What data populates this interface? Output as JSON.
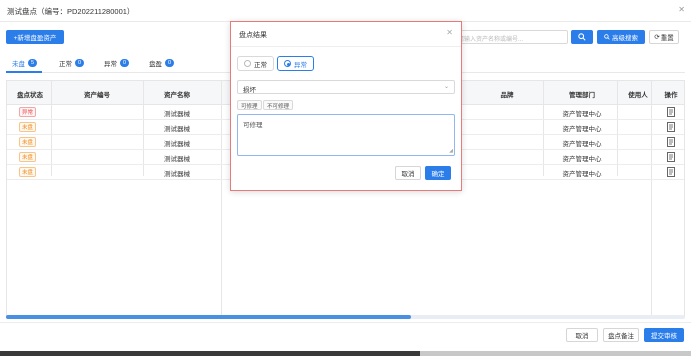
{
  "window": {
    "title": "测试盘点（编号：PD202211280001）"
  },
  "toolbar": {
    "add_label": "+新增盘盈资产",
    "search_placeholder": "请输入资产名称或编号...",
    "advanced_label": "高级搜索",
    "reset_label": "重置"
  },
  "tabs": [
    {
      "label": "未盘",
      "count": "5"
    },
    {
      "label": "正常",
      "count": "0"
    },
    {
      "label": "异常",
      "count": "0"
    },
    {
      "label": "盘盈",
      "count": "0"
    }
  ],
  "table": {
    "columns": [
      "盘点状态",
      "资产编号",
      "资产名称",
      "品牌",
      "管理部门",
      "使用人",
      "操作"
    ],
    "rows": [
      {
        "status": "异常",
        "status_type": "error",
        "code": "",
        "name": "测试器械",
        "brand": "",
        "dept": "资产管理中心",
        "user": ""
      },
      {
        "status": "未盘",
        "status_type": "pending",
        "code": "",
        "name": "测试器械",
        "brand": "",
        "dept": "资产管理中心",
        "user": ""
      },
      {
        "status": "未盘",
        "status_type": "pending",
        "code": "",
        "name": "测试器械",
        "brand": "",
        "dept": "资产管理中心",
        "user": ""
      },
      {
        "status": "未盘",
        "status_type": "pending",
        "code": "",
        "name": "测试器械",
        "brand": "",
        "dept": "资产管理中心",
        "user": ""
      },
      {
        "status": "未盘",
        "status_type": "pending",
        "code": "",
        "name": "测试器械",
        "brand": "",
        "dept": "资产管理中心",
        "user": ""
      }
    ]
  },
  "footer": {
    "cancel_label": "取消",
    "note_label": "盘点备注",
    "submit_label": "提交审核"
  },
  "modal": {
    "title": "盘点结果",
    "radio_normal": "正常",
    "radio_abnormal": "异常",
    "selected": "异常",
    "select_value": "损坏",
    "chips": [
      "可修理",
      "不可修理"
    ],
    "textarea_value": "可修理",
    "cancel_label": "取消",
    "confirm_label": "确定"
  },
  "colors": {
    "primary": "#2b7de9",
    "error": "#e64b4b",
    "pending": "#f08a1c"
  },
  "icons": {
    "close": "close-icon",
    "search": "search-icon",
    "operate": "document-icon"
  }
}
